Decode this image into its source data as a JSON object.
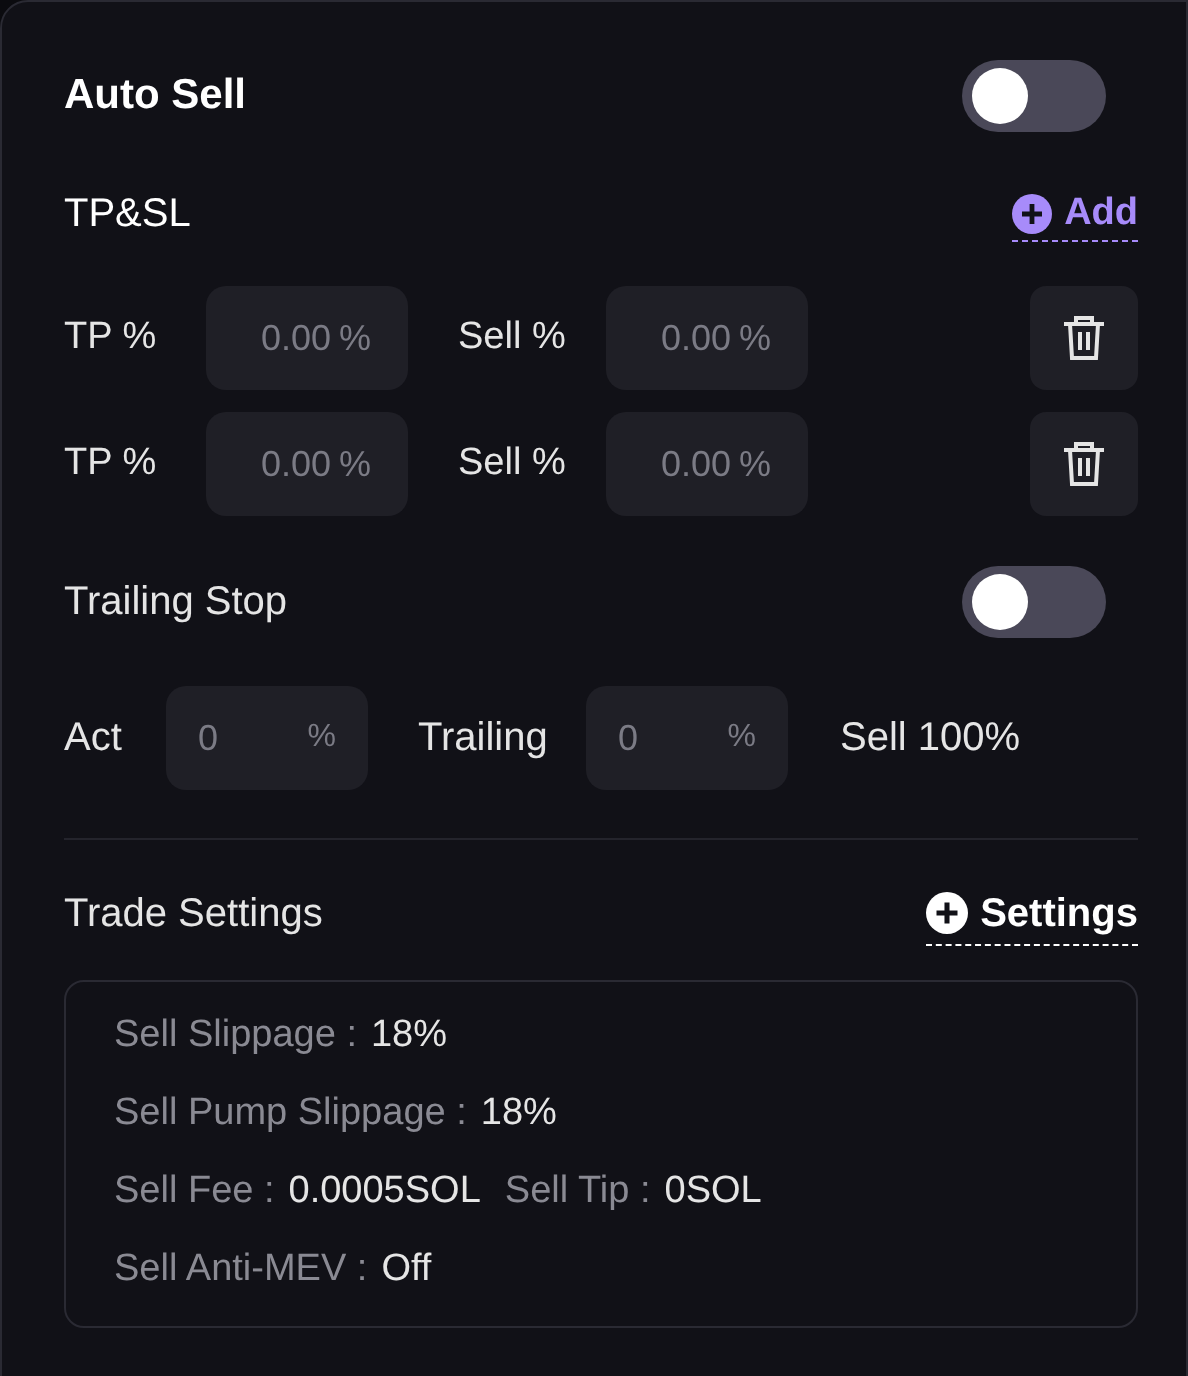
{
  "auto_sell": {
    "title": "Auto Sell",
    "on": false
  },
  "tp_sl": {
    "title": "TP&SL",
    "add_link": "Add",
    "rows": [
      {
        "tp_label": "TP %",
        "tp_placeholder": "0.00",
        "tp_unit": "%",
        "sell_label": "Sell %",
        "sell_placeholder": "0.00",
        "sell_unit": "%"
      },
      {
        "tp_label": "TP %",
        "tp_placeholder": "0.00",
        "tp_unit": "%",
        "sell_label": "Sell %",
        "sell_placeholder": "0.00",
        "sell_unit": "%"
      }
    ]
  },
  "trailing_stop": {
    "title": "Trailing Stop",
    "on": false,
    "act_label": "Act",
    "act_placeholder": "0",
    "act_unit": "%",
    "trailing_label": "Trailing",
    "trailing_placeholder": "0",
    "trailing_unit": "%",
    "sell_text": "Sell 100%"
  },
  "trade_settings": {
    "title": "Trade Settings",
    "settings_link": "Settings",
    "lines": [
      [
        {
          "label": "Sell Slippage :",
          "value": "18%"
        }
      ],
      [
        {
          "label": "Sell Pump Slippage :",
          "value": "18%"
        }
      ],
      [
        {
          "label": "Sell Fee :",
          "value": "0.0005SOL"
        },
        {
          "label": "Sell Tip :",
          "value": "0SOL"
        }
      ],
      [
        {
          "label": "Sell Anti-MEV :",
          "value": "Off"
        }
      ]
    ]
  }
}
